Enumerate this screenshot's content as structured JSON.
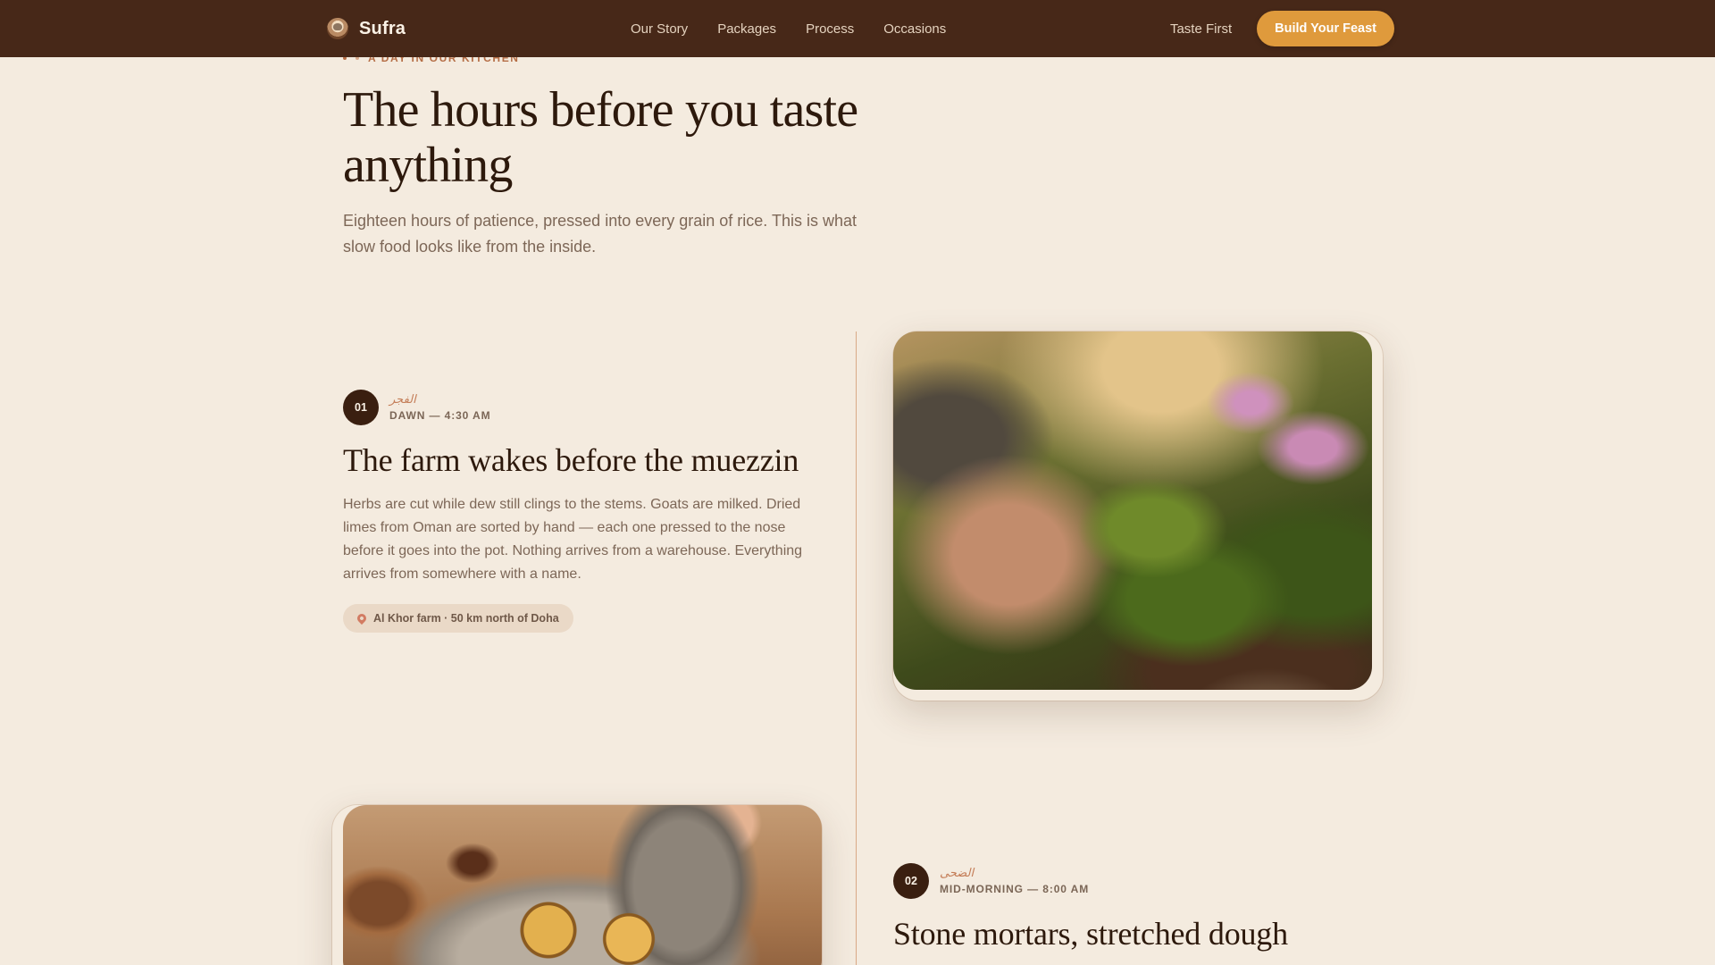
{
  "nav": {
    "brand": "Sufra",
    "brand_icon": "chef-logo-icon",
    "links": [
      "Our Story",
      "Packages",
      "Process",
      "Occasions"
    ],
    "taste_first": "Taste First",
    "cta": "Build Your Feast"
  },
  "hero": {
    "eyebrow": "A DAY IN OUR KITCHEN",
    "title": "The hours before you taste anything",
    "subtitle": "Eighteen hours of patience, pressed into every grain of rice. This is what slow food looks like from the inside."
  },
  "steps": [
    {
      "num": "01",
      "arabic": "الفجر",
      "time": "DAWN — 4:30 AM",
      "title": "The farm wakes before the muezzin",
      "body": "Herbs are cut while dew still clings to the stems. Goats are milked. Dried limes from Oman are sorted by hand — each one pressed to the nose before it goes into the pot. Nothing arrives from a warehouse. Everything arrives from somewhere with a name.",
      "location": "Al Khor farm · 50 km north of Doha",
      "location_icon": "map-pin-icon",
      "image": "hands-harvesting-herbs-photo"
    },
    {
      "num": "02",
      "arabic": "الضحى",
      "time": "MID-MORNING — 8:00 AM",
      "title": "Stone mortars, stretched dough",
      "image": "stone-mortar-dried-limes-photo"
    }
  ],
  "colors": {
    "nav_bg": "#472818",
    "page_bg": "#f4ebdf",
    "accent": "#df9a3c",
    "heading": "#2d190c",
    "eyebrow": "#b56e46"
  }
}
